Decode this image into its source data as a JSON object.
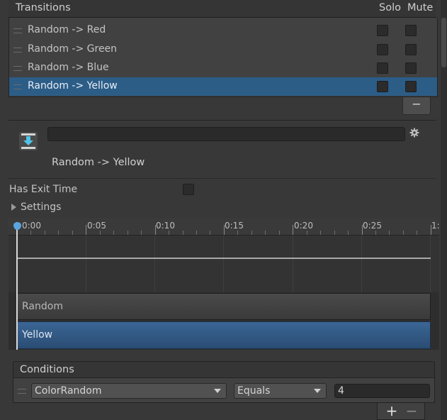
{
  "transitions": {
    "title": "Transitions",
    "solo_header": "Solo",
    "mute_header": "Mute",
    "items": [
      {
        "label": "Random -> Red",
        "solo": false,
        "mute": false,
        "selected": false
      },
      {
        "label": "Random -> Green",
        "solo": false,
        "mute": false,
        "selected": false
      },
      {
        "label": "Random -> Blue",
        "solo": false,
        "mute": false,
        "selected": false
      },
      {
        "label": "Random -> Yellow",
        "solo": false,
        "mute": false,
        "selected": true
      }
    ],
    "remove_label": "−"
  },
  "inspector": {
    "name_value": "",
    "subtitle": "Random -> Yellow",
    "has_exit_time_label": "Has Exit Time",
    "has_exit_time": false,
    "settings_label": "Settings"
  },
  "timeline": {
    "ticks": [
      "0:00",
      "0:05",
      "0:10",
      "0:15",
      "0:20",
      "0:25",
      "1:"
    ],
    "source_state": "Random",
    "destination_state": "Yellow",
    "playhead_time": "0:00"
  },
  "conditions": {
    "title": "Conditions",
    "parameter": "ColorRandom",
    "operator": "Equals",
    "value": "4",
    "add_label": "+",
    "remove_label": "−"
  },
  "colors": {
    "selection": "#2c5d87",
    "destination_bar": "#3b6695",
    "playhead_knob": "#5aa4e0"
  }
}
